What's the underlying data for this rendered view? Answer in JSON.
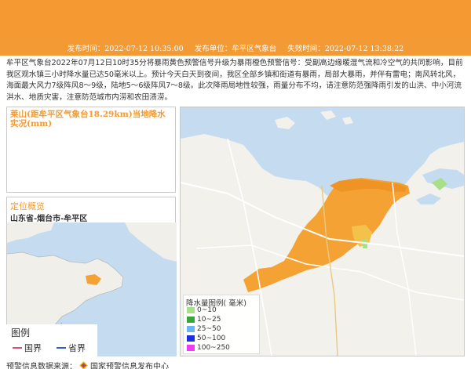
{
  "header": {
    "publish_time": "发布时间：2022-07-12 10:35:00",
    "publisher": "发布单位：牟平区气象台",
    "expire_time": "失效时间：2022-07-12 13:38:22"
  },
  "description": "牟平区气象台2022年07月12日10时35分将暴雨黄色预警信号升级为暴雨橙色预警信号：受副高边缘暖湿气流和冷空气的共同影响，目前我区观水镇三小时降水量已达50毫米以上。预计今天白天到夜间，我区全部乡镇和街道有暴雨，局部大暴雨，并伴有雷电；南风转北风，海面最大风力7级阵风8～9级，陆地5～6级阵风7～8级。此次降雨局地性较强，雨量分布不均，请注意防范强降雨引发的山洪、中小河流洪水、地质灾害，注意防范城市内涝和农田渍涝。",
  "rain_panel": {
    "title": "莱山(距牟平区气象台18.29km)当地降水实况(mm)"
  },
  "location_panel": {
    "title": "定位概览",
    "region": "山东省-烟台市-牟平区"
  },
  "map_legend": {
    "title": "图例",
    "items": [
      {
        "label": "国界",
        "color": "#d9506a"
      },
      {
        "label": "省界",
        "color": "#2b5fc4"
      }
    ]
  },
  "rain_legend": {
    "title": "降水量图例( 毫米)",
    "items": [
      {
        "label": "0~10",
        "color": "#a8e08a"
      },
      {
        "label": "10~25",
        "color": "#3aa63a"
      },
      {
        "label": "25~50",
        "color": "#6fb4f2"
      },
      {
        "label": "50~100",
        "color": "#1a2fe0"
      },
      {
        "label": "100~250",
        "color": "#f03cf0"
      }
    ]
  },
  "source": {
    "label": "预警信息数据来源：",
    "org": "国家预警信息发布中心"
  },
  "colors": {
    "brand_orange": "#f39a35",
    "warning_area": "#f5a234",
    "sea": "#c4dbf0",
    "land": "#f3f1ec"
  }
}
